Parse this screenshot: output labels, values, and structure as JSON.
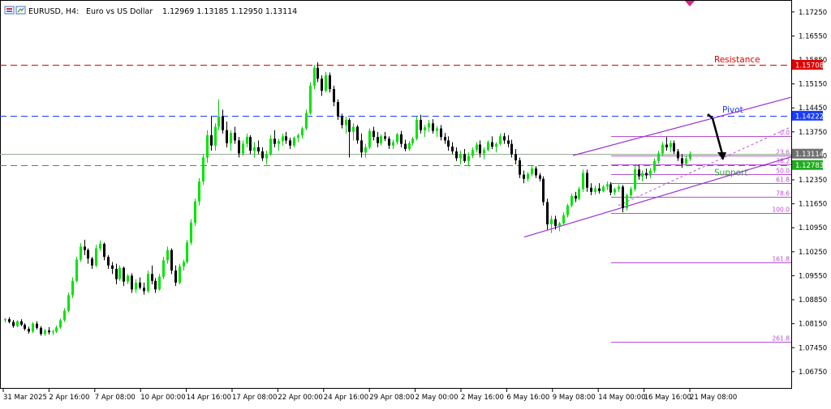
{
  "header": {
    "symbol": "EURUSD, H4:",
    "description": "Euro vs US Dollar",
    "ohlc": "1.12969 1.13185 1.12950 1.13114"
  },
  "chart_data": {
    "type": "candlestick",
    "ylim": [
      1.0625,
      1.176
    ],
    "y_ticks": [
      "1.17250",
      "1.16550",
      "1.15850",
      "1.15150",
      "1.14450",
      "1.13750",
      "1.13050",
      "1.12350",
      "1.11650",
      "1.10950",
      "1.10250",
      "1.09550",
      "1.08850",
      "1.08150",
      "1.07450",
      "1.06750"
    ],
    "x_ticks": [
      "31 Mar 2025",
      "2 Apr 16:00",
      "7 Apr 08:00",
      "10 Apr 00:00",
      "14 Apr 16:00",
      "17 Apr 08:00",
      "22 Apr 00:00",
      "24 Apr 16:00",
      "29 Apr 08:00",
      "2 May 00:00",
      "2 May 16:00",
      "6 May 16:00",
      "9 May 08:00",
      "14 May 00:00",
      "16 May 16:00",
      "21 May 08:00"
    ],
    "levels": [
      {
        "label": "Resistance",
        "value": 1.15708,
        "tag": "1.15708",
        "color": "#e00000"
      },
      {
        "label": "Pivot",
        "value": 1.14222,
        "tag": "1.14222",
        "color": "#1a3cff"
      },
      {
        "label": "Support",
        "value": 1.12783,
        "tag": "1.12783",
        "color": "#22aa22"
      }
    ],
    "current_price": {
      "value": 1.13114,
      "tag": "1.13114"
    },
    "fibonacci": [
      {
        "label": "0.0",
        "value": 1.1363
      },
      {
        "label": "23.6",
        "value": 1.1307
      },
      {
        "label": "38.2",
        "value": 1.1279
      },
      {
        "label": "50.0",
        "value": 1.1252
      },
      {
        "label": "61.8",
        "value": 1.1226
      },
      {
        "label": "78.6",
        "value": 1.1186
      },
      {
        "label": "100.0",
        "value": 1.1137
      },
      {
        "label": "161.8",
        "value": 1.0994
      },
      {
        "label": "261.8",
        "value": 1.0762
      }
    ],
    "channel": {
      "lower": {
        "from": [
          -999,
          1.1068
        ],
        "to": [
          -999,
          1.1302
        ]
      },
      "upper": {
        "from": [
          -999,
          1.1306
        ],
        "to": [
          -999,
          1.1476
        ]
      }
    },
    "candles": [
      [
        1.0825,
        1.0832,
        1.0818,
        1.0828
      ],
      [
        1.0828,
        1.0834,
        1.0816,
        1.082
      ],
      [
        1.082,
        1.0826,
        1.0803,
        1.0808
      ],
      [
        1.0808,
        1.0825,
        1.0805,
        1.0822
      ],
      [
        1.0822,
        1.0828,
        1.0808,
        1.0812
      ],
      [
        1.0812,
        1.0816,
        1.0795,
        1.08
      ],
      [
        1.08,
        1.0806,
        1.0786,
        1.0792
      ],
      [
        1.0792,
        1.082,
        1.0788,
        1.0815
      ],
      [
        1.0815,
        1.0822,
        1.0798,
        1.0803
      ],
      [
        1.0803,
        1.0808,
        1.078,
        1.0785
      ],
      [
        1.0785,
        1.08,
        1.078,
        1.0795
      ],
      [
        1.0795,
        1.0805,
        1.0783,
        1.079
      ],
      [
        1.079,
        1.0798,
        1.0782,
        1.0792
      ],
      [
        1.0792,
        1.081,
        1.0788,
        1.0804
      ],
      [
        1.0804,
        1.083,
        1.08,
        1.0825
      ],
      [
        1.0825,
        1.086,
        1.082,
        1.0853
      ],
      [
        1.0853,
        1.0905,
        1.0848,
        1.0898
      ],
      [
        1.0898,
        1.095,
        1.089,
        1.094
      ],
      [
        1.094,
        1.101,
        1.0935,
        1.1002
      ],
      [
        1.1002,
        1.105,
        1.0995,
        1.104
      ],
      [
        1.104,
        1.106,
        1.1015,
        1.103
      ],
      [
        1.103,
        1.1035,
        1.099,
        1.1005
      ],
      [
        1.1005,
        1.101,
        1.0975,
        1.0985
      ],
      [
        1.0985,
        1.1045,
        1.098,
        1.1035
      ],
      [
        1.1035,
        1.1058,
        1.1028,
        1.1048
      ],
      [
        1.1048,
        1.1052,
        1.1,
        1.101
      ],
      [
        1.101,
        1.1015,
        1.0975,
        1.0985
      ],
      [
        1.0985,
        1.0995,
        1.096,
        1.0975
      ],
      [
        1.0975,
        1.099,
        1.093,
        1.0945
      ],
      [
        1.0945,
        1.0985,
        1.094,
        1.0978
      ],
      [
        1.0978,
        1.0982,
        1.0925,
        1.0938
      ],
      [
        1.0938,
        1.096,
        1.093,
        1.0955
      ],
      [
        1.0955,
        1.0962,
        1.0905,
        1.0915
      ],
      [
        1.0915,
        1.0945,
        1.0905,
        1.0935
      ],
      [
        1.0935,
        1.095,
        1.0915,
        1.092
      ],
      [
        1.092,
        1.0935,
        1.09,
        1.091
      ],
      [
        1.091,
        1.097,
        1.0905,
        1.096
      ],
      [
        1.096,
        1.0985,
        1.093,
        1.094
      ],
      [
        1.094,
        1.0948,
        1.0905,
        1.0915
      ],
      [
        1.0915,
        1.096,
        1.0912,
        1.0952
      ],
      [
        1.0952,
        1.101,
        1.0945,
        1.1
      ],
      [
        1.1,
        1.104,
        1.099,
        1.103
      ],
      [
        1.103,
        1.1035,
        1.096,
        1.097
      ],
      [
        1.097,
        1.0985,
        1.0925,
        1.0935
      ],
      [
        1.0935,
        1.099,
        1.093,
        1.0982
      ],
      [
        1.0982,
        1.1002,
        1.097,
        1.0995
      ],
      [
        1.0995,
        1.106,
        1.099,
        1.1052
      ],
      [
        1.1052,
        1.112,
        1.1045,
        1.111
      ],
      [
        1.111,
        1.118,
        1.11,
        1.1172
      ],
      [
        1.1172,
        1.124,
        1.116,
        1.123
      ],
      [
        1.123,
        1.131,
        1.122,
        1.13
      ],
      [
        1.13,
        1.138,
        1.1285,
        1.1365
      ],
      [
        1.1365,
        1.142,
        1.132,
        1.1335
      ],
      [
        1.1335,
        1.14,
        1.132,
        1.139
      ],
      [
        1.139,
        1.147,
        1.138,
        1.142
      ],
      [
        1.142,
        1.144,
        1.137,
        1.138
      ],
      [
        1.138,
        1.1405,
        1.133,
        1.1342
      ],
      [
        1.1342,
        1.138,
        1.132,
        1.1372
      ],
      [
        1.1372,
        1.139,
        1.134,
        1.135
      ],
      [
        1.135,
        1.136,
        1.13,
        1.1312
      ],
      [
        1.1312,
        1.135,
        1.1305,
        1.134
      ],
      [
        1.134,
        1.137,
        1.133,
        1.136
      ],
      [
        1.136,
        1.1365,
        1.131,
        1.132
      ],
      [
        1.132,
        1.1345,
        1.13,
        1.133
      ],
      [
        1.133,
        1.135,
        1.131,
        1.1318
      ],
      [
        1.1318,
        1.133,
        1.129,
        1.1298
      ],
      [
        1.1298,
        1.132,
        1.128,
        1.131
      ],
      [
        1.131,
        1.1365,
        1.1305,
        1.1355
      ],
      [
        1.1355,
        1.138,
        1.133,
        1.134
      ],
      [
        1.134,
        1.1355,
        1.132,
        1.1348
      ],
      [
        1.1348,
        1.137,
        1.1335,
        1.1362
      ],
      [
        1.1362,
        1.1375,
        1.134,
        1.135
      ],
      [
        1.135,
        1.1358,
        1.1325,
        1.1335
      ],
      [
        1.1335,
        1.1362,
        1.133,
        1.1358
      ],
      [
        1.1358,
        1.137,
        1.1345,
        1.1365
      ],
      [
        1.1365,
        1.139,
        1.1355,
        1.1385
      ],
      [
        1.1385,
        1.144,
        1.138,
        1.143
      ],
      [
        1.143,
        1.152,
        1.1425,
        1.151
      ],
      [
        1.151,
        1.157,
        1.15,
        1.1562
      ],
      [
        1.1562,
        1.1578,
        1.152,
        1.153
      ],
      [
        1.153,
        1.154,
        1.148,
        1.1495
      ],
      [
        1.1495,
        1.155,
        1.149,
        1.154
      ],
      [
        1.154,
        1.1548,
        1.149,
        1.15
      ],
      [
        1.15,
        1.151,
        1.145,
        1.1462
      ],
      [
        1.1462,
        1.147,
        1.141,
        1.142
      ],
      [
        1.142,
        1.1428,
        1.1385,
        1.1395
      ],
      [
        1.1395,
        1.142,
        1.137,
        1.141
      ],
      [
        1.141,
        1.1415,
        1.13,
        1.1375
      ],
      [
        1.1375,
        1.14,
        1.135,
        1.139
      ],
      [
        1.139,
        1.1395,
        1.134,
        1.135
      ],
      [
        1.135,
        1.137,
        1.13,
        1.1315
      ],
      [
        1.1315,
        1.134,
        1.13,
        1.133
      ],
      [
        1.133,
        1.1385,
        1.1325,
        1.1378
      ],
      [
        1.1378,
        1.139,
        1.135,
        1.136
      ],
      [
        1.136,
        1.1375,
        1.133,
        1.1342
      ],
      [
        1.1342,
        1.1368,
        1.1335,
        1.1362
      ],
      [
        1.1362,
        1.1375,
        1.1348,
        1.1355
      ],
      [
        1.1355,
        1.1362,
        1.1325,
        1.1335
      ],
      [
        1.1335,
        1.1352,
        1.1325,
        1.1345
      ],
      [
        1.1345,
        1.1372,
        1.1338,
        1.1368
      ],
      [
        1.1368,
        1.1378,
        1.133,
        1.134
      ],
      [
        1.134,
        1.1352,
        1.1318,
        1.1325
      ],
      [
        1.1325,
        1.1348,
        1.132,
        1.1342
      ],
      [
        1.1342,
        1.136,
        1.1335,
        1.1355
      ],
      [
        1.1355,
        1.142,
        1.135,
        1.141
      ],
      [
        1.141,
        1.1425,
        1.137,
        1.138
      ],
      [
        1.138,
        1.1395,
        1.136,
        1.1388
      ],
      [
        1.1388,
        1.141,
        1.1375,
        1.14
      ],
      [
        1.14,
        1.1412,
        1.137,
        1.1378
      ],
      [
        1.1378,
        1.1392,
        1.136,
        1.1385
      ],
      [
        1.1385,
        1.1395,
        1.135,
        1.136
      ],
      [
        1.136,
        1.1372,
        1.134,
        1.135
      ],
      [
        1.135,
        1.1362,
        1.132,
        1.1332
      ],
      [
        1.1332,
        1.1345,
        1.131,
        1.1318
      ],
      [
        1.1318,
        1.133,
        1.129,
        1.1298
      ],
      [
        1.1298,
        1.132,
        1.128,
        1.131
      ],
      [
        1.131,
        1.1325,
        1.1285,
        1.129
      ],
      [
        1.129,
        1.1315,
        1.1275,
        1.1305
      ],
      [
        1.1305,
        1.133,
        1.1298,
        1.1322
      ],
      [
        1.1322,
        1.1345,
        1.1315,
        1.1338
      ],
      [
        1.1338,
        1.135,
        1.13,
        1.1312
      ],
      [
        1.1312,
        1.133,
        1.1295,
        1.1322
      ],
      [
        1.1322,
        1.135,
        1.1318,
        1.1345
      ],
      [
        1.1345,
        1.1362,
        1.1325,
        1.1332
      ],
      [
        1.1332,
        1.1345,
        1.1315,
        1.134
      ],
      [
        1.134,
        1.137,
        1.1335,
        1.1362
      ],
      [
        1.1362,
        1.1372,
        1.134,
        1.135
      ],
      [
        1.135,
        1.1365,
        1.133,
        1.134
      ],
      [
        1.134,
        1.1352,
        1.13,
        1.131
      ],
      [
        1.131,
        1.1325,
        1.128,
        1.1292
      ],
      [
        1.1292,
        1.13,
        1.124,
        1.125
      ],
      [
        1.125,
        1.1262,
        1.1225,
        1.1238
      ],
      [
        1.1238,
        1.1258,
        1.123,
        1.1252
      ],
      [
        1.1252,
        1.1275,
        1.1245,
        1.1268
      ],
      [
        1.1268,
        1.1275,
        1.124,
        1.1248
      ],
      [
        1.1248,
        1.1255,
        1.123,
        1.1238
      ],
      [
        1.1238,
        1.1245,
        1.116,
        1.117
      ],
      [
        1.117,
        1.118,
        1.109,
        1.1105
      ],
      [
        1.1105,
        1.113,
        1.108,
        1.112
      ],
      [
        1.112,
        1.113,
        1.109,
        1.11
      ],
      [
        1.11,
        1.1112,
        1.1085,
        1.1108
      ],
      [
        1.1108,
        1.114,
        1.1102,
        1.1132
      ],
      [
        1.1132,
        1.1165,
        1.1125,
        1.116
      ],
      [
        1.116,
        1.1195,
        1.1155,
        1.1188
      ],
      [
        1.1188,
        1.12,
        1.117,
        1.118
      ],
      [
        1.118,
        1.1215,
        1.1175,
        1.1208
      ],
      [
        1.1208,
        1.1265,
        1.12,
        1.1255
      ],
      [
        1.1255,
        1.1265,
        1.12,
        1.1212
      ],
      [
        1.1212,
        1.1225,
        1.119,
        1.12
      ],
      [
        1.12,
        1.1218,
        1.1192,
        1.121
      ],
      [
        1.121,
        1.1225,
        1.1195,
        1.1202
      ],
      [
        1.1202,
        1.122,
        1.1198,
        1.1215
      ],
      [
        1.1215,
        1.123,
        1.1205,
        1.1222
      ],
      [
        1.1222,
        1.1228,
        1.119,
        1.1198
      ],
      [
        1.1198,
        1.1212,
        1.119,
        1.1208
      ],
      [
        1.1208,
        1.1222,
        1.12,
        1.1215
      ],
      [
        1.1215,
        1.122,
        1.114,
        1.1152
      ],
      [
        1.1152,
        1.1195,
        1.1145,
        1.119
      ],
      [
        1.119,
        1.1215,
        1.118,
        1.1208
      ],
      [
        1.1208,
        1.1275,
        1.1202,
        1.1265
      ],
      [
        1.1265,
        1.128,
        1.1235,
        1.1245
      ],
      [
        1.1245,
        1.1262,
        1.123,
        1.1255
      ],
      [
        1.1255,
        1.1268,
        1.1238,
        1.1248
      ],
      [
        1.1248,
        1.127,
        1.124,
        1.1262
      ],
      [
        1.1262,
        1.1298,
        1.1255,
        1.129
      ],
      [
        1.129,
        1.132,
        1.1282,
        1.1312
      ],
      [
        1.1312,
        1.1345,
        1.1305,
        1.1338
      ],
      [
        1.1338,
        1.136,
        1.132,
        1.133
      ],
      [
        1.133,
        1.135,
        1.1315,
        1.1342
      ],
      [
        1.1342,
        1.135,
        1.131,
        1.1318
      ],
      [
        1.1318,
        1.1325,
        1.129,
        1.1298
      ],
      [
        1.1298,
        1.131,
        1.127,
        1.1282
      ],
      [
        1.1282,
        1.1305,
        1.1275,
        1.1297
      ],
      [
        1.1297,
        1.1318,
        1.129,
        1.1311
      ]
    ]
  }
}
